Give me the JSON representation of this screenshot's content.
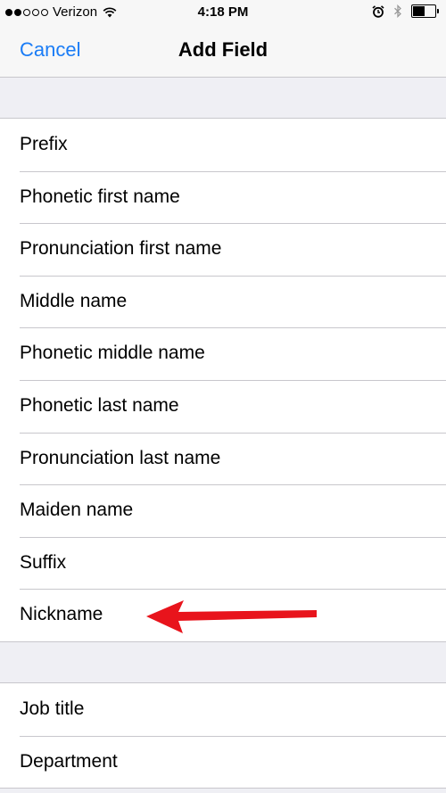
{
  "status_bar": {
    "carrier": "Verizon",
    "time": "4:18 PM",
    "signal_bars_filled": 2,
    "signal_bars_total": 5,
    "battery_level": 0.55
  },
  "nav": {
    "cancel_label": "Cancel",
    "title": "Add Field"
  },
  "fields_group_1": [
    {
      "label": "Prefix"
    },
    {
      "label": "Phonetic first name"
    },
    {
      "label": "Pronunciation first name"
    },
    {
      "label": "Middle name"
    },
    {
      "label": "Phonetic middle name"
    },
    {
      "label": "Phonetic last name"
    },
    {
      "label": "Pronunciation last name"
    },
    {
      "label": "Maiden name"
    },
    {
      "label": "Suffix"
    },
    {
      "label": "Nickname"
    }
  ],
  "fields_group_2": [
    {
      "label": "Job title"
    },
    {
      "label": "Department"
    }
  ],
  "colors": {
    "accent": "#1a7cf6",
    "annotation_arrow": "#e8141c",
    "background": "#efeff4",
    "separator": "#c8c7cc"
  },
  "icons": [
    "wifi-icon",
    "alarm-icon",
    "bluetooth-icon",
    "battery-icon",
    "annotation-arrow-icon"
  ]
}
